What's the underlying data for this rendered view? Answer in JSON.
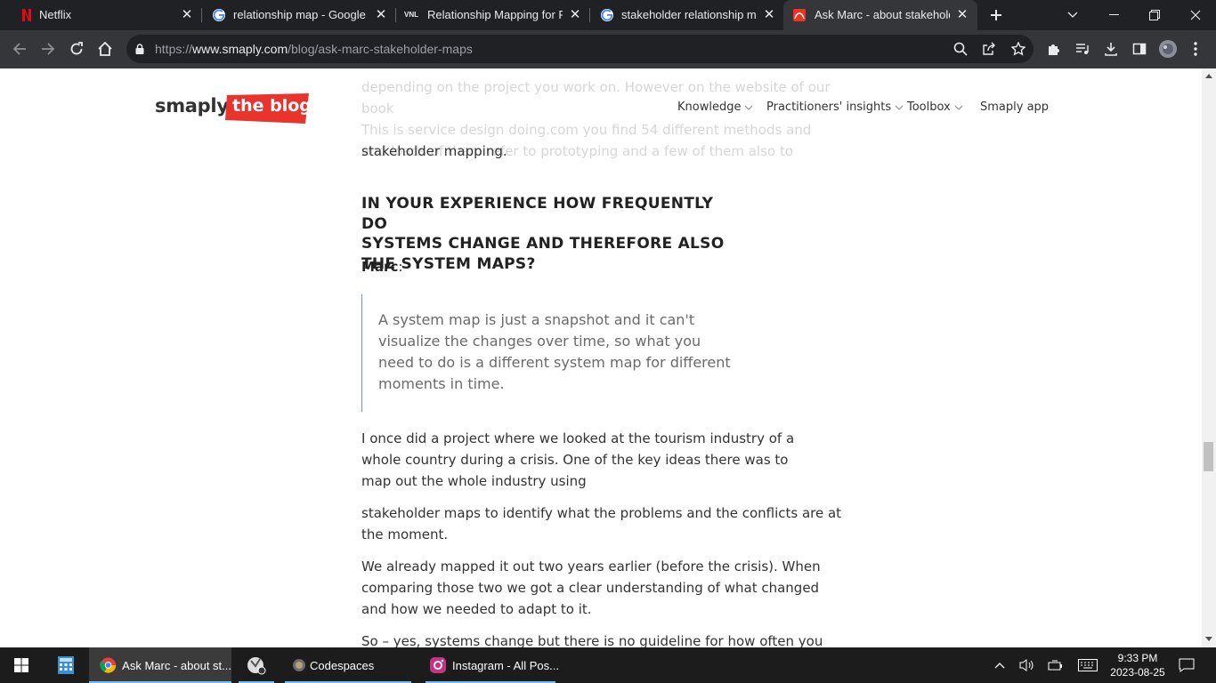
{
  "browser": {
    "tabs": [
      {
        "title": "Netflix",
        "favicon": "netflix-icon"
      },
      {
        "title": "relationship map - Google Se",
        "favicon": "google-icon"
      },
      {
        "title": "Relationship Mapping for Pul",
        "favicon": "vnl-icon"
      },
      {
        "title": "stakeholder relationship map",
        "favicon": "google-icon"
      },
      {
        "title": "Ask Marc - about stakeholde",
        "favicon": "smaply-icon",
        "active": true
      }
    ],
    "favicon_labels": {
      "vnl": "VNL"
    },
    "url_prefix": "https://",
    "url_host": "www.smaply.com",
    "url_path": "/blog/ask-marc-stakeholder-maps"
  },
  "site": {
    "logo_main": "smaply",
    "logo_badge": "the blog",
    "nav": [
      "Knowledge",
      "Practitioners' insights",
      "Toolbox",
      "Smaply app"
    ]
  },
  "article": {
    "faded_lines": [
      "depending on the project you work on. However on the website of our book",
      "This is service design doing.com you find 54 different methods and",
      "and loads of them refer to prototyping and a few of them also to"
    ],
    "line_stakeholder": "stakeholder mapping.",
    "heading_lines": [
      "IN YOUR EXPERIENCE HOW FREQUENTLY DO",
      "SYSTEMS CHANGE AND THEREFORE ALSO",
      "THE SYSTEM MAPS?"
    ],
    "speaker_name": "Marc",
    "speaker_colon": ":",
    "quote": "A system map is just a snapshot and it can't visualize the changes over time, so what you need to do is a different system map for different moments in time.",
    "para1": "I once did a project where we looked at the tourism industry of a whole country during a crisis. One of the key ideas there was to map out the whole industry using",
    "para2": "stakeholder maps to identify what the problems and the conflicts are at the moment.",
    "para3": "We already mapped it out two years earlier (before the crisis). When comparing those two we got a clear understanding of what changed and how we needed to adapt to it.",
    "para4": "So – yes, systems change but there is no guideline for how often you"
  },
  "taskbar": {
    "apps": [
      {
        "label": "Ask Marc - about st...",
        "icon": "chrome-icon"
      },
      {
        "label": "Codespaces",
        "icon": "codespaces-icon"
      },
      {
        "label": "Instagram - All Pos...",
        "icon": "instagram-icon"
      }
    ],
    "time": "9:33 PM",
    "date": "2023-08-25"
  }
}
